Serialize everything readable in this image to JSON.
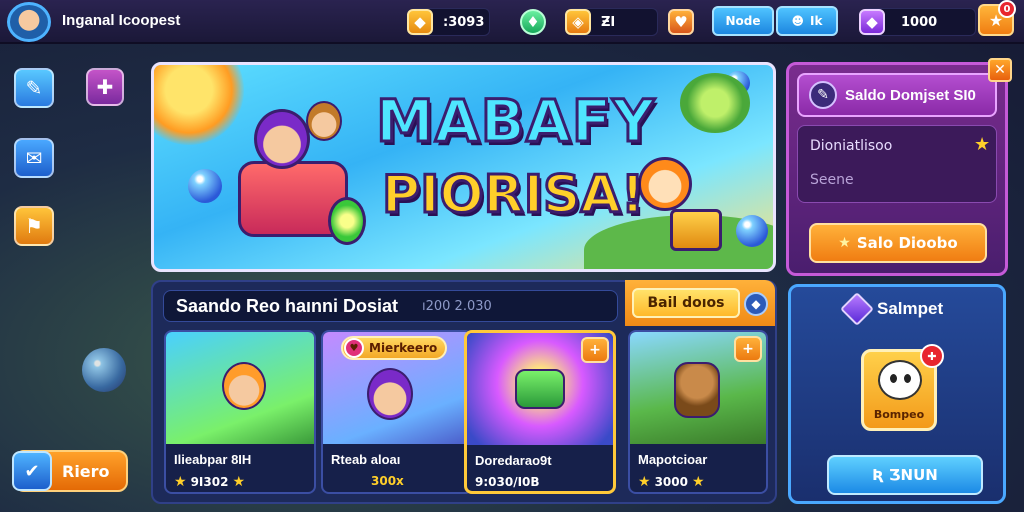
{
  "header": {
    "player_name": "Inganal Icoopest",
    "coins": ":3093",
    "gems": "",
    "tickets": "ƵI",
    "btn_mode": "Node",
    "btn_friends": "Ik",
    "premium": "1000",
    "notification_count": "0"
  },
  "sidebar": {
    "hero_button": "Riero"
  },
  "banner": {
    "title_line1": "MABAFY",
    "title_line2": "PIORISA!"
  },
  "event": {
    "title": "Saando Reo haınni Dosiat",
    "code": "ı200 2.030",
    "tab_button": "Bail doıos",
    "cards": [
      {
        "name": "Ilieabpar 8IH",
        "price": "9I302",
        "badge": ""
      },
      {
        "name": "Rteab aloaı",
        "price": "300x",
        "badge": "Mierkeero"
      },
      {
        "name": "Doredarao9t",
        "price": "9:030/I0B",
        "badge": ""
      },
      {
        "name": "Mapotcioar",
        "price": "3000",
        "badge": ""
      }
    ]
  },
  "promo": {
    "header": "Saldo Domjset SI0",
    "line1": "Dioniatlisoo",
    "line2": "Seene",
    "button": "Salo Dioobo"
  },
  "reward": {
    "title": "Salmpet",
    "item_label": "Bompeo",
    "button": "Ʀ ƷNUN"
  },
  "colors": {
    "accent_orange": "#f08a16",
    "accent_blue": "#1c86e0",
    "panel_purple": "#7a2c8e",
    "panel_navy": "#1d2a5a"
  }
}
